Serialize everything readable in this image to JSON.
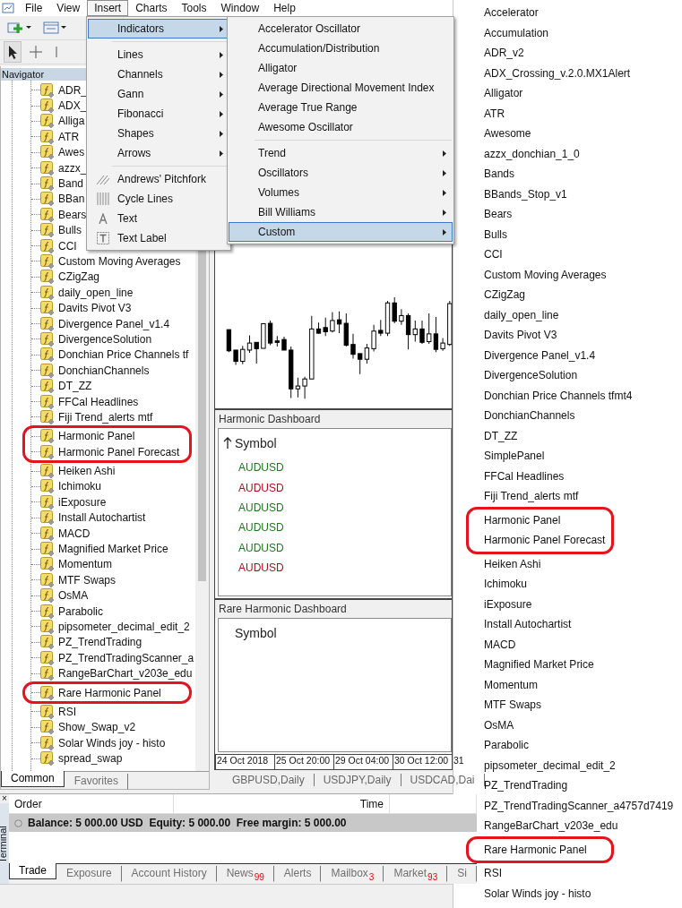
{
  "menu_bar": [
    {
      "label": "File",
      "selected": false
    },
    {
      "label": "View",
      "selected": false
    },
    {
      "label": "Insert",
      "selected": true
    },
    {
      "label": "Charts",
      "selected": false
    },
    {
      "label": "Tools",
      "selected": false
    },
    {
      "label": "Window",
      "selected": false
    },
    {
      "label": "Help",
      "selected": false
    }
  ],
  "insert_menu": [
    {
      "kind": "submenu",
      "label": "Indicators",
      "selected": true
    },
    {
      "kind": "separator"
    },
    {
      "kind": "submenu",
      "label": "Lines",
      "selected": false
    },
    {
      "kind": "submenu",
      "label": "Channels",
      "selected": false
    },
    {
      "kind": "submenu",
      "label": "Gann",
      "selected": false
    },
    {
      "kind": "submenu",
      "label": "Fibonacci",
      "selected": false
    },
    {
      "kind": "submenu",
      "label": "Shapes",
      "selected": false
    },
    {
      "kind": "submenu",
      "label": "Arrows",
      "selected": false
    },
    {
      "kind": "separator"
    },
    {
      "kind": "command",
      "label": "Andrews' Pitchfork",
      "selected": false
    },
    {
      "kind": "command",
      "label": "Cycle Lines",
      "selected": false
    },
    {
      "kind": "command",
      "label": "Text",
      "selected": false
    },
    {
      "kind": "command",
      "label": "Text Label",
      "selected": false
    }
  ],
  "indicators_menu": [
    {
      "kind": "command",
      "label": "Accelerator Oscillator",
      "selected": false
    },
    {
      "kind": "command",
      "label": "Accumulation/Distribution",
      "selected": false
    },
    {
      "kind": "command",
      "label": "Alligator",
      "selected": false
    },
    {
      "kind": "command",
      "label": "Average Directional Movement Index",
      "selected": false
    },
    {
      "kind": "command",
      "label": "Average True Range",
      "selected": false
    },
    {
      "kind": "command",
      "label": "Awesome Oscillator",
      "selected": false
    },
    {
      "kind": "separator"
    },
    {
      "kind": "submenu",
      "label": "Trend",
      "selected": false
    },
    {
      "kind": "submenu",
      "label": "Oscillators",
      "selected": false
    },
    {
      "kind": "submenu",
      "label": "Volumes",
      "selected": false
    },
    {
      "kind": "submenu",
      "label": "Bill Williams",
      "selected": false
    },
    {
      "kind": "submenu",
      "label": "Custom",
      "selected": true
    }
  ],
  "navigator": {
    "title": "Navigator",
    "items": [
      {
        "label": "ADR_",
        "highlighted": false
      },
      {
        "label": "ADX_",
        "highlighted": false
      },
      {
        "label": "Alliga",
        "highlighted": false
      },
      {
        "label": "ATR",
        "highlighted": false
      },
      {
        "label": "Awes",
        "highlighted": false
      },
      {
        "label": "azzx_",
        "highlighted": false
      },
      {
        "label": "Band",
        "highlighted": false
      },
      {
        "label": "BBan",
        "highlighted": false
      },
      {
        "label": "Bears",
        "highlighted": false
      },
      {
        "label": "Bulls",
        "highlighted": false
      },
      {
        "label": "CCI",
        "highlighted": false
      },
      {
        "label": "Custom Moving Averages",
        "highlighted": false
      },
      {
        "label": "CZigZag",
        "highlighted": false
      },
      {
        "label": "daily_open_line",
        "highlighted": false
      },
      {
        "label": "Davits Pivot V3",
        "highlighted": false
      },
      {
        "label": "Divergence Panel_v1.4",
        "highlighted": false
      },
      {
        "label": "DivergenceSolution",
        "highlighted": false
      },
      {
        "label": "Donchian Price Channels tf",
        "highlighted": false
      },
      {
        "label": "DonchianChannels",
        "highlighted": false
      },
      {
        "label": "DT_ZZ",
        "highlighted": false
      },
      {
        "label": "FFCal Headlines",
        "highlighted": false
      },
      {
        "label": "Fiji Trend_alerts mtf",
        "highlighted": false
      },
      {
        "label": "Harmonic Panel",
        "highlighted": true
      },
      {
        "label": "Harmonic Panel Forecast",
        "highlighted": true
      },
      {
        "label": "Heiken Ashi",
        "highlighted": false
      },
      {
        "label": "Ichimoku",
        "highlighted": false
      },
      {
        "label": "iExposure",
        "highlighted": false
      },
      {
        "label": "Install Autochartist",
        "highlighted": false
      },
      {
        "label": "MACD",
        "highlighted": false
      },
      {
        "label": "Magnified Market Price",
        "highlighted": false
      },
      {
        "label": "Momentum",
        "highlighted": false
      },
      {
        "label": "MTF Swaps",
        "highlighted": false
      },
      {
        "label": "OsMA",
        "highlighted": false
      },
      {
        "label": "Parabolic",
        "highlighted": false
      },
      {
        "label": "pipsometer_decimal_edit_2",
        "highlighted": false
      },
      {
        "label": "PZ_TrendTrading",
        "highlighted": false
      },
      {
        "label": "PZ_TrendTradingScanner_a",
        "highlighted": false
      },
      {
        "label": "RangeBarChart_v203e_edu",
        "highlighted": false
      },
      {
        "label": "Rare Harmonic Panel",
        "highlighted": true
      },
      {
        "label": "RSI",
        "highlighted": false
      },
      {
        "label": "Show_Swap_v2",
        "highlighted": false
      },
      {
        "label": "Solar Winds joy - histo",
        "highlighted": false
      },
      {
        "label": "spread_swap",
        "highlighted": false
      }
    ],
    "tabs": [
      {
        "label": "Common",
        "selected": true
      },
      {
        "label": "Favorites",
        "selected": false
      }
    ]
  },
  "chart": {
    "dashboards": [
      {
        "title": "Harmonic Dashboard",
        "column": "Symbol",
        "sorted": true,
        "rows": [
          {
            "symbol": "AUDUSD",
            "color": "#1a7a1a"
          },
          {
            "symbol": "AUDUSD",
            "color": "#a8101c"
          },
          {
            "symbol": "AUDUSD",
            "color": "#1a7a1a"
          },
          {
            "symbol": "AUDUSD",
            "color": "#1a7a1a"
          },
          {
            "symbol": "AUDUSD",
            "color": "#1a7a1a"
          },
          {
            "symbol": "AUDUSD",
            "color": "#a8101c"
          }
        ]
      },
      {
        "title": "Rare Harmonic Dashboard",
        "column": "Symbol",
        "sorted": false
      }
    ],
    "time_labels": [
      "24 Oct 2018",
      "25 Oct 20:00",
      "29 Oct 04:00",
      "30 Oct 12:00",
      "31"
    ],
    "tabs": [
      "GBPUSD,Daily",
      "USDJPY,Daily",
      "USDCAD,Dai"
    ]
  },
  "terminal": {
    "close": "×",
    "title": "Terminal",
    "columns": [
      "Order",
      "Time"
    ],
    "balance": "Balance: 5 000.00 USD  Equity: 5 000.00  Free margin: 5 000.00",
    "tabs": [
      {
        "label": "Trade",
        "selected": true
      },
      {
        "label": "Exposure",
        "selected": false
      },
      {
        "label": "Account History",
        "selected": false
      },
      {
        "label": "News",
        "count": "99",
        "selected": false
      },
      {
        "label": "Alerts",
        "selected": false
      },
      {
        "label": "Mailbox",
        "count": "3",
        "selected": false
      },
      {
        "label": "Market",
        "count": "93",
        "selected": false
      },
      {
        "label": "Si",
        "selected": false
      }
    ]
  },
  "indicator_list": [
    {
      "label": "Accelerator",
      "highlighted": false
    },
    {
      "label": "Accumulation",
      "highlighted": false
    },
    {
      "label": "ADR_v2",
      "highlighted": false
    },
    {
      "label": "ADX_Crossing_v.2.0.MX1Alert",
      "highlighted": false
    },
    {
      "label": "Alligator",
      "highlighted": false
    },
    {
      "label": "ATR",
      "highlighted": false
    },
    {
      "label": "Awesome",
      "highlighted": false
    },
    {
      "label": "azzx_donchian_1_0",
      "highlighted": false
    },
    {
      "label": "Bands",
      "highlighted": false
    },
    {
      "label": "BBands_Stop_v1",
      "highlighted": false
    },
    {
      "label": "Bears",
      "highlighted": false
    },
    {
      "label": "Bulls",
      "highlighted": false
    },
    {
      "label": "CCI",
      "highlighted": false
    },
    {
      "label": "Custom Moving Averages",
      "highlighted": false
    },
    {
      "label": "CZigZag",
      "highlighted": false
    },
    {
      "label": "daily_open_line",
      "highlighted": false
    },
    {
      "label": "Davits Pivot V3",
      "highlighted": false
    },
    {
      "label": "Divergence Panel_v1.4",
      "highlighted": false
    },
    {
      "label": "DivergenceSolution",
      "highlighted": false
    },
    {
      "label": "Donchian Price Channels tfmt4",
      "highlighted": false
    },
    {
      "label": "DonchianChannels",
      "highlighted": false
    },
    {
      "label": "DT_ZZ",
      "highlighted": false
    },
    {
      "label": "SimplePanel",
      "highlighted": false
    },
    {
      "label": "FFCal Headlines",
      "highlighted": false
    },
    {
      "label": "Fiji Trend_alerts mtf",
      "highlighted": false
    },
    {
      "label": "Harmonic Panel",
      "highlighted": true
    },
    {
      "label": "Harmonic Panel Forecast",
      "highlighted": true
    },
    {
      "label": "Heiken Ashi",
      "highlighted": false
    },
    {
      "label": "Ichimoku",
      "highlighted": false
    },
    {
      "label": "iExposure",
      "highlighted": false
    },
    {
      "label": "Install Autochartist",
      "highlighted": false
    },
    {
      "label": "MACD",
      "highlighted": false
    },
    {
      "label": "Magnified Market Price",
      "highlighted": false
    },
    {
      "label": "Momentum",
      "highlighted": false
    },
    {
      "label": "MTF Swaps",
      "highlighted": false
    },
    {
      "label": "OsMA",
      "highlighted": false
    },
    {
      "label": "Parabolic",
      "highlighted": false
    },
    {
      "label": "pipsometer_decimal_edit_2",
      "highlighted": false
    },
    {
      "label": "PZ_TrendTrading",
      "highlighted": false
    },
    {
      "label": "PZ_TrendTradingScanner_a4757d7419",
      "highlighted": false
    },
    {
      "label": "RangeBarChart_v203e_edu",
      "highlighted": false
    },
    {
      "label": "Rare Harmonic Panel",
      "highlighted": true
    },
    {
      "label": "RSI",
      "highlighted": false
    },
    {
      "label": "Solar Winds joy - histo",
      "highlighted": false
    }
  ]
}
